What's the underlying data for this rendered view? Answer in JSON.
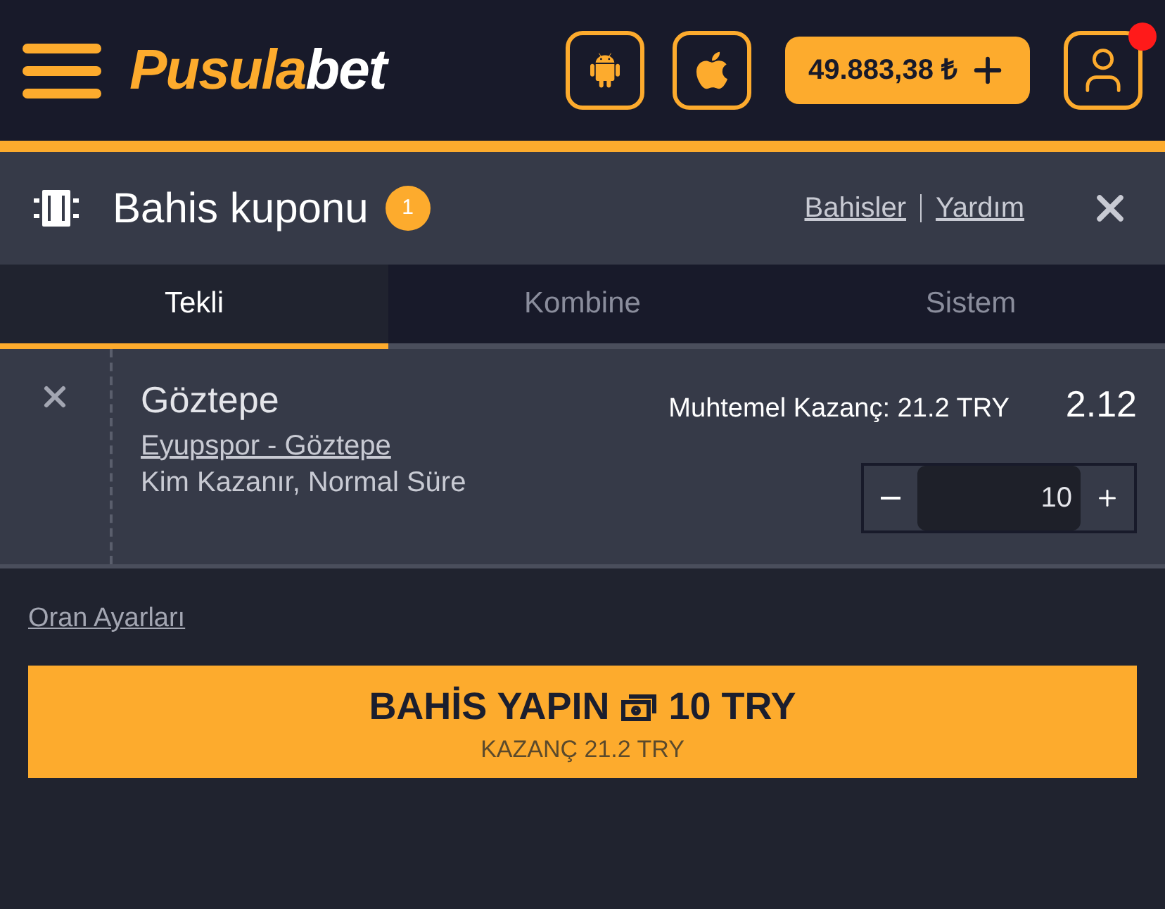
{
  "header": {
    "logo": [
      "Pusula",
      "bet"
    ],
    "balance": "49.883,38 ₺",
    "notification": true
  },
  "coupon": {
    "title": "Bahis kuponu",
    "count": "1",
    "links": [
      "Bahisler",
      "Yardım"
    ]
  },
  "tabs": [
    {
      "label": "Tekli",
      "selected": true
    },
    {
      "label": "Kombine",
      "selected": false
    },
    {
      "label": "Sistem",
      "selected": false
    }
  ],
  "bet": {
    "selection": "Göztepe",
    "match": "Eyupspor - Göztepe",
    "market": "Kim Kazanır, Normal Süre",
    "potential": "Muhtemel Kazanç: 21.2 TRY",
    "odds": "2.12",
    "stake": "10"
  },
  "odds_settings": "Oran Ayarları",
  "place_bet": {
    "label": "BAHİS YAPIN",
    "amount": "10 TRY",
    "winnings": "KAZANÇ 21.2 TRY"
  }
}
